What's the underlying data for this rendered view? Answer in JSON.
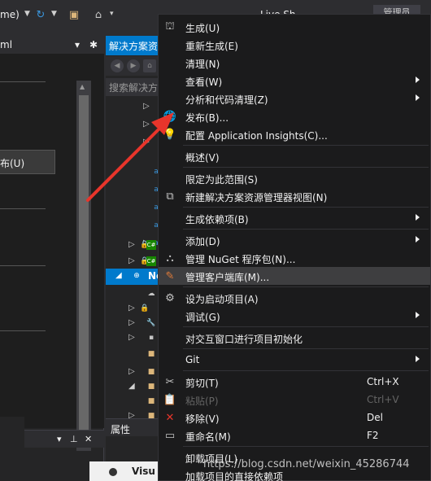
{
  "toolbar": {
    "config_text": "me)",
    "managed_label": "管理员",
    "live_share_text": "Live Sh"
  },
  "left_panel": {
    "tab_title": "ml",
    "publish_text": "布(U)"
  },
  "solution_explorer": {
    "title": "解决方案资源管理器",
    "search_placeholder": "搜索解决方案资源管理器",
    "selected_node": "Ne"
  },
  "properties_panel": {
    "title": "属性"
  },
  "vis_popup": {
    "text": "Visu"
  },
  "context_menu": {
    "items": [
      {
        "label": "生成(U)",
        "icon": "build-icon"
      },
      {
        "label": "重新生成(E)"
      },
      {
        "label": "清理(N)"
      },
      {
        "label": "查看(W)",
        "submenu": true
      },
      {
        "label": "分析和代码清理(Z)",
        "submenu": true
      },
      {
        "label": "发布(B)...",
        "icon": "publish-globe-icon"
      },
      {
        "label": "配置 Application Insights(C)...",
        "icon": "insights-icon"
      },
      {
        "label": "概述(V)"
      },
      {
        "label": "限定为此范围(S)"
      },
      {
        "label": "新建解决方案资源管理器视图(N)",
        "icon": "new-view-icon"
      },
      {
        "label": "生成依赖项(B)",
        "submenu": true
      },
      {
        "label": "添加(D)",
        "submenu": true
      },
      {
        "label": "管理 NuGet 程序包(N)...",
        "icon": "nuget-icon"
      },
      {
        "label": "管理客户端库(M)...",
        "icon": "client-library-icon"
      },
      {
        "label": "设为启动项目(A)",
        "icon": "gear-icon"
      },
      {
        "label": "调试(G)",
        "submenu": true
      },
      {
        "label": "对交互窗口进行项目初始化"
      },
      {
        "label": "Git",
        "submenu": true
      },
      {
        "label": "剪切(T)",
        "shortcut": "Ctrl+X",
        "icon": "cut-icon"
      },
      {
        "label": "粘贴(P)",
        "shortcut": "Ctrl+V",
        "icon": "paste-icon"
      },
      {
        "label": "移除(V)",
        "shortcut": "Del",
        "icon": "remove-icon"
      },
      {
        "label": "重命名(M)",
        "shortcut": "F2",
        "icon": "rename-icon"
      },
      {
        "label": "卸载项目(L)"
      },
      {
        "label": "加载项目的直接依赖项"
      }
    ]
  },
  "watermark": "https://blog.csdn.net/weixin_45286744",
  "colors": {
    "accent": "#007acc",
    "menu_bg": "#1b1b1c",
    "hover_bg": "#3e3e40",
    "annotation_arrow": "#e8352b"
  }
}
